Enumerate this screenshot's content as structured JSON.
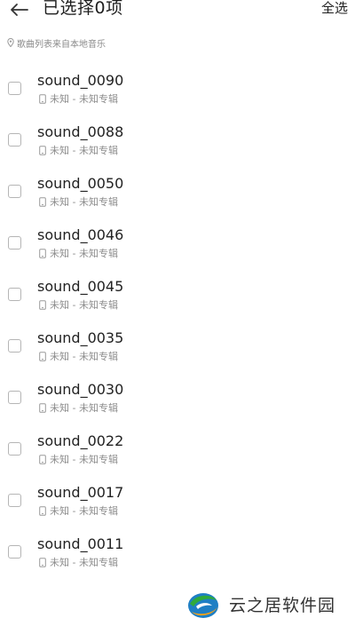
{
  "header": {
    "back_icon": "arrow-left-icon",
    "title": "已选择0项",
    "select_all_label": "全选"
  },
  "source_note": {
    "icon": "location-pin-icon",
    "text": "歌曲列表来自本地音乐"
  },
  "songs": [
    {
      "title": "sound_0090",
      "meta": "未知 - 未知专辑"
    },
    {
      "title": "sound_0088",
      "meta": "未知 - 未知专辑"
    },
    {
      "title": "sound_0050",
      "meta": "未知 - 未知专辑"
    },
    {
      "title": "sound_0046",
      "meta": "未知 - 未知专辑"
    },
    {
      "title": "sound_0045",
      "meta": "未知 - 未知专辑"
    },
    {
      "title": "sound_0035",
      "meta": "未知 - 未知专辑"
    },
    {
      "title": "sound_0030",
      "meta": "未知 - 未知专辑"
    },
    {
      "title": "sound_0022",
      "meta": "未知 - 未知专辑"
    },
    {
      "title": "sound_0017",
      "meta": "未知 - 未知专辑"
    },
    {
      "title": "sound_0011",
      "meta": "未知 - 未知专辑"
    }
  ],
  "watermark": {
    "text": "云之居软件园"
  },
  "colors": {
    "title": "#1f1f1f",
    "secondary_text": "#8c8c8c",
    "checkbox_border": "#b5b5b5"
  }
}
